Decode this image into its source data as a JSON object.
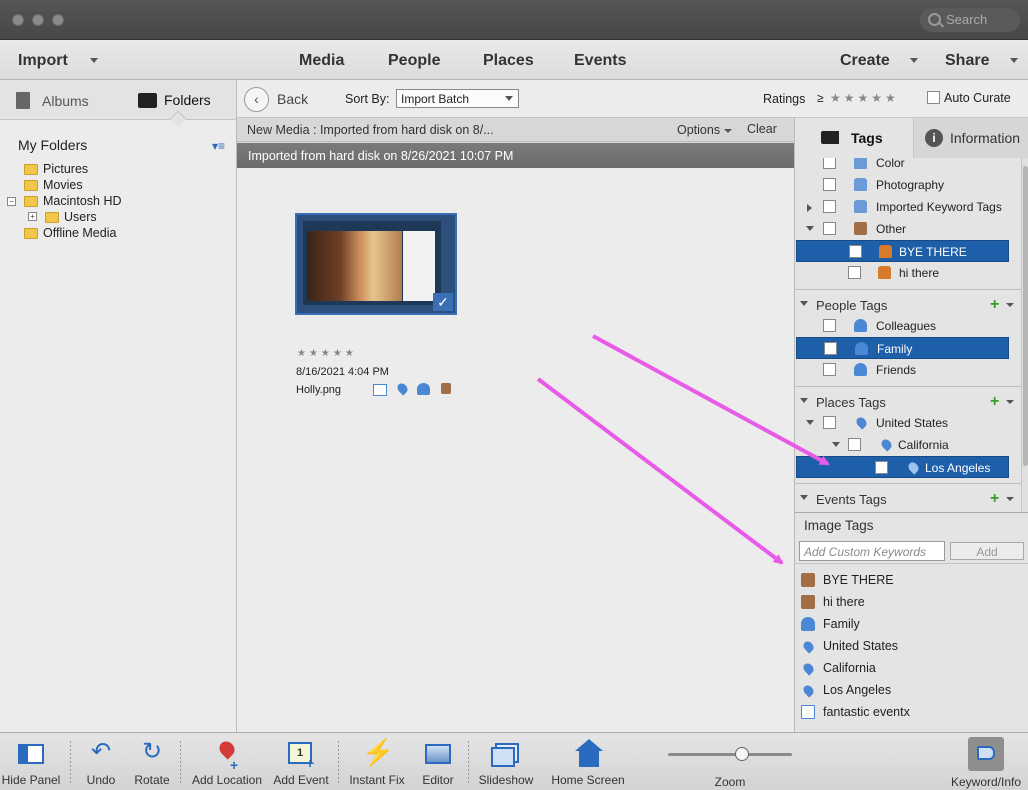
{
  "window": {
    "search_placeholder": "Search"
  },
  "menubar": {
    "import": "Import",
    "media": "Media",
    "people": "People",
    "places": "Places",
    "events": "Events",
    "create": "Create",
    "share": "Share"
  },
  "left_tabs": {
    "albums": "Albums",
    "folders": "Folders"
  },
  "my_folders": {
    "title": "My Folders",
    "items": [
      "Pictures",
      "Movies",
      "Macintosh HD",
      "Users",
      "Offline Media"
    ]
  },
  "toolbar": {
    "back": "Back",
    "sort_by_label": "Sort By:",
    "sort_value": "Import Batch",
    "ratings": "Ratings",
    "ratings_op": "≥",
    "auto_curate": "Auto Curate"
  },
  "crumb": {
    "text": "New Media : Imported from hard disk on 8/...",
    "options": "Options",
    "clear": "Clear"
  },
  "group_header": "Imported from hard disk on 8/26/2021 10:07 PM",
  "thumbnail": {
    "date": "8/16/2021 4:04 PM",
    "filename": "Holly.png",
    "stars": "★★★★★",
    "rating": 0
  },
  "right_tabs": {
    "tags": "Tags",
    "information": "Information"
  },
  "keyword_tags": [
    {
      "label": "Color",
      "icon": "tag-blue"
    },
    {
      "label": "Photography",
      "icon": "tag-blue"
    },
    {
      "label": "Imported Keyword Tags",
      "icon": "tag-blue"
    },
    {
      "label": "Other",
      "icon": "tag-brown"
    },
    {
      "label": "BYE THERE",
      "icon": "tag-orange"
    },
    {
      "label": "hi there",
      "icon": "tag-orange"
    }
  ],
  "people_tags": {
    "title": "People Tags",
    "items": [
      "Colleagues",
      "Family",
      "Friends"
    ]
  },
  "places_tags": {
    "title": "Places Tags",
    "items": [
      "United States",
      "California",
      "Los Angeles"
    ]
  },
  "events_tags": {
    "title": "Events Tags"
  },
  "image_tags": {
    "title": "Image Tags",
    "placeholder": "Add Custom Keywords",
    "add": "Add",
    "items": [
      {
        "label": "BYE THERE",
        "icon": "keyword-icon"
      },
      {
        "label": "hi there",
        "icon": "keyword-icon"
      },
      {
        "label": "Family",
        "icon": "person-icon"
      },
      {
        "label": "United States",
        "icon": "place-pin-icon"
      },
      {
        "label": "California",
        "icon": "place-pin-icon"
      },
      {
        "label": "Los Angeles",
        "icon": "place-pin-icon"
      },
      {
        "label": "fantastic eventx",
        "icon": "event-calendar-icon"
      }
    ]
  },
  "bottom_bar": {
    "hide_panel": "Hide Panel",
    "undo": "Undo",
    "rotate": "Rotate",
    "add_location": "Add Location",
    "add_event": "Add Event",
    "instant_fix": "Instant Fix",
    "editor": "Editor",
    "slideshow": "Slideshow",
    "home_screen": "Home Screen",
    "zoom": "Zoom",
    "keyword_info": "Keyword/Info",
    "zoom_level": 0.6
  },
  "colors": {
    "selection": "#1e5faa",
    "annotation_arrow": "#e85be8",
    "add_green": "#3a9b2f"
  }
}
